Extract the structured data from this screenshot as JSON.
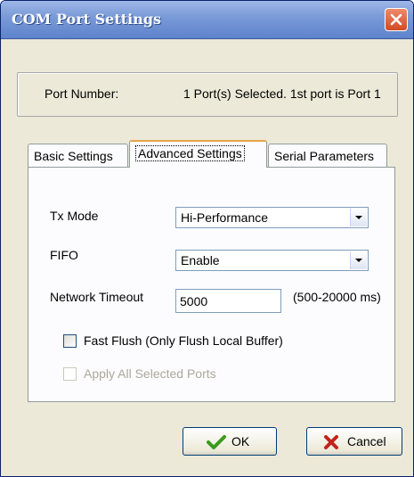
{
  "window": {
    "title": "COM Port Settings"
  },
  "port": {
    "label": "Port Number:",
    "value": "1 Port(s) Selected. 1st port is Port 1"
  },
  "tabs": [
    {
      "label": "Basic Settings",
      "active": false
    },
    {
      "label": "Advanced Settings",
      "active": true
    },
    {
      "label": "Serial Parameters",
      "active": false
    }
  ],
  "advanced": {
    "tx_mode": {
      "label": "Tx Mode",
      "value": "Hi-Performance"
    },
    "fifo": {
      "label": "FIFO",
      "value": "Enable"
    },
    "network_timeout": {
      "label": "Network Timeout",
      "value": "5000",
      "range": "(500-20000 ms)"
    },
    "fast_flush": {
      "label": "Fast Flush (Only Flush Local Buffer)",
      "checked": false,
      "enabled": true
    },
    "apply_all": {
      "label": "Apply All Selected Ports",
      "checked": false,
      "enabled": false
    }
  },
  "buttons": {
    "ok": "OK",
    "cancel": "Cancel"
  },
  "icons": {
    "close": "close-icon",
    "ok": "checkmark-icon",
    "cancel": "x-icon",
    "dropdown": "chevron-down-icon"
  },
  "colors": {
    "titlebar": "#7b9bd8",
    "close": "#d24a24",
    "ok_check": "#3a9a1c",
    "cancel_x": "#c0241c",
    "active_tab": "#e5a54a"
  }
}
